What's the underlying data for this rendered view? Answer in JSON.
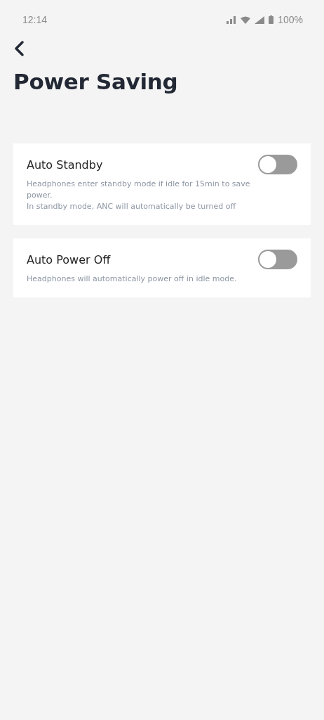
{
  "status_bar": {
    "time": "12:14",
    "battery": "100%"
  },
  "title": "Power Saving",
  "settings": [
    {
      "label": "Auto Standby",
      "description": "Headphones enter standby mode if idle for 15min to save power.\nIn standby mode, ANC will automatically be turned off",
      "on": false
    },
    {
      "label": "Auto Power Off",
      "description": "Headphones will automatically power off in idle mode.",
      "on": false
    }
  ]
}
